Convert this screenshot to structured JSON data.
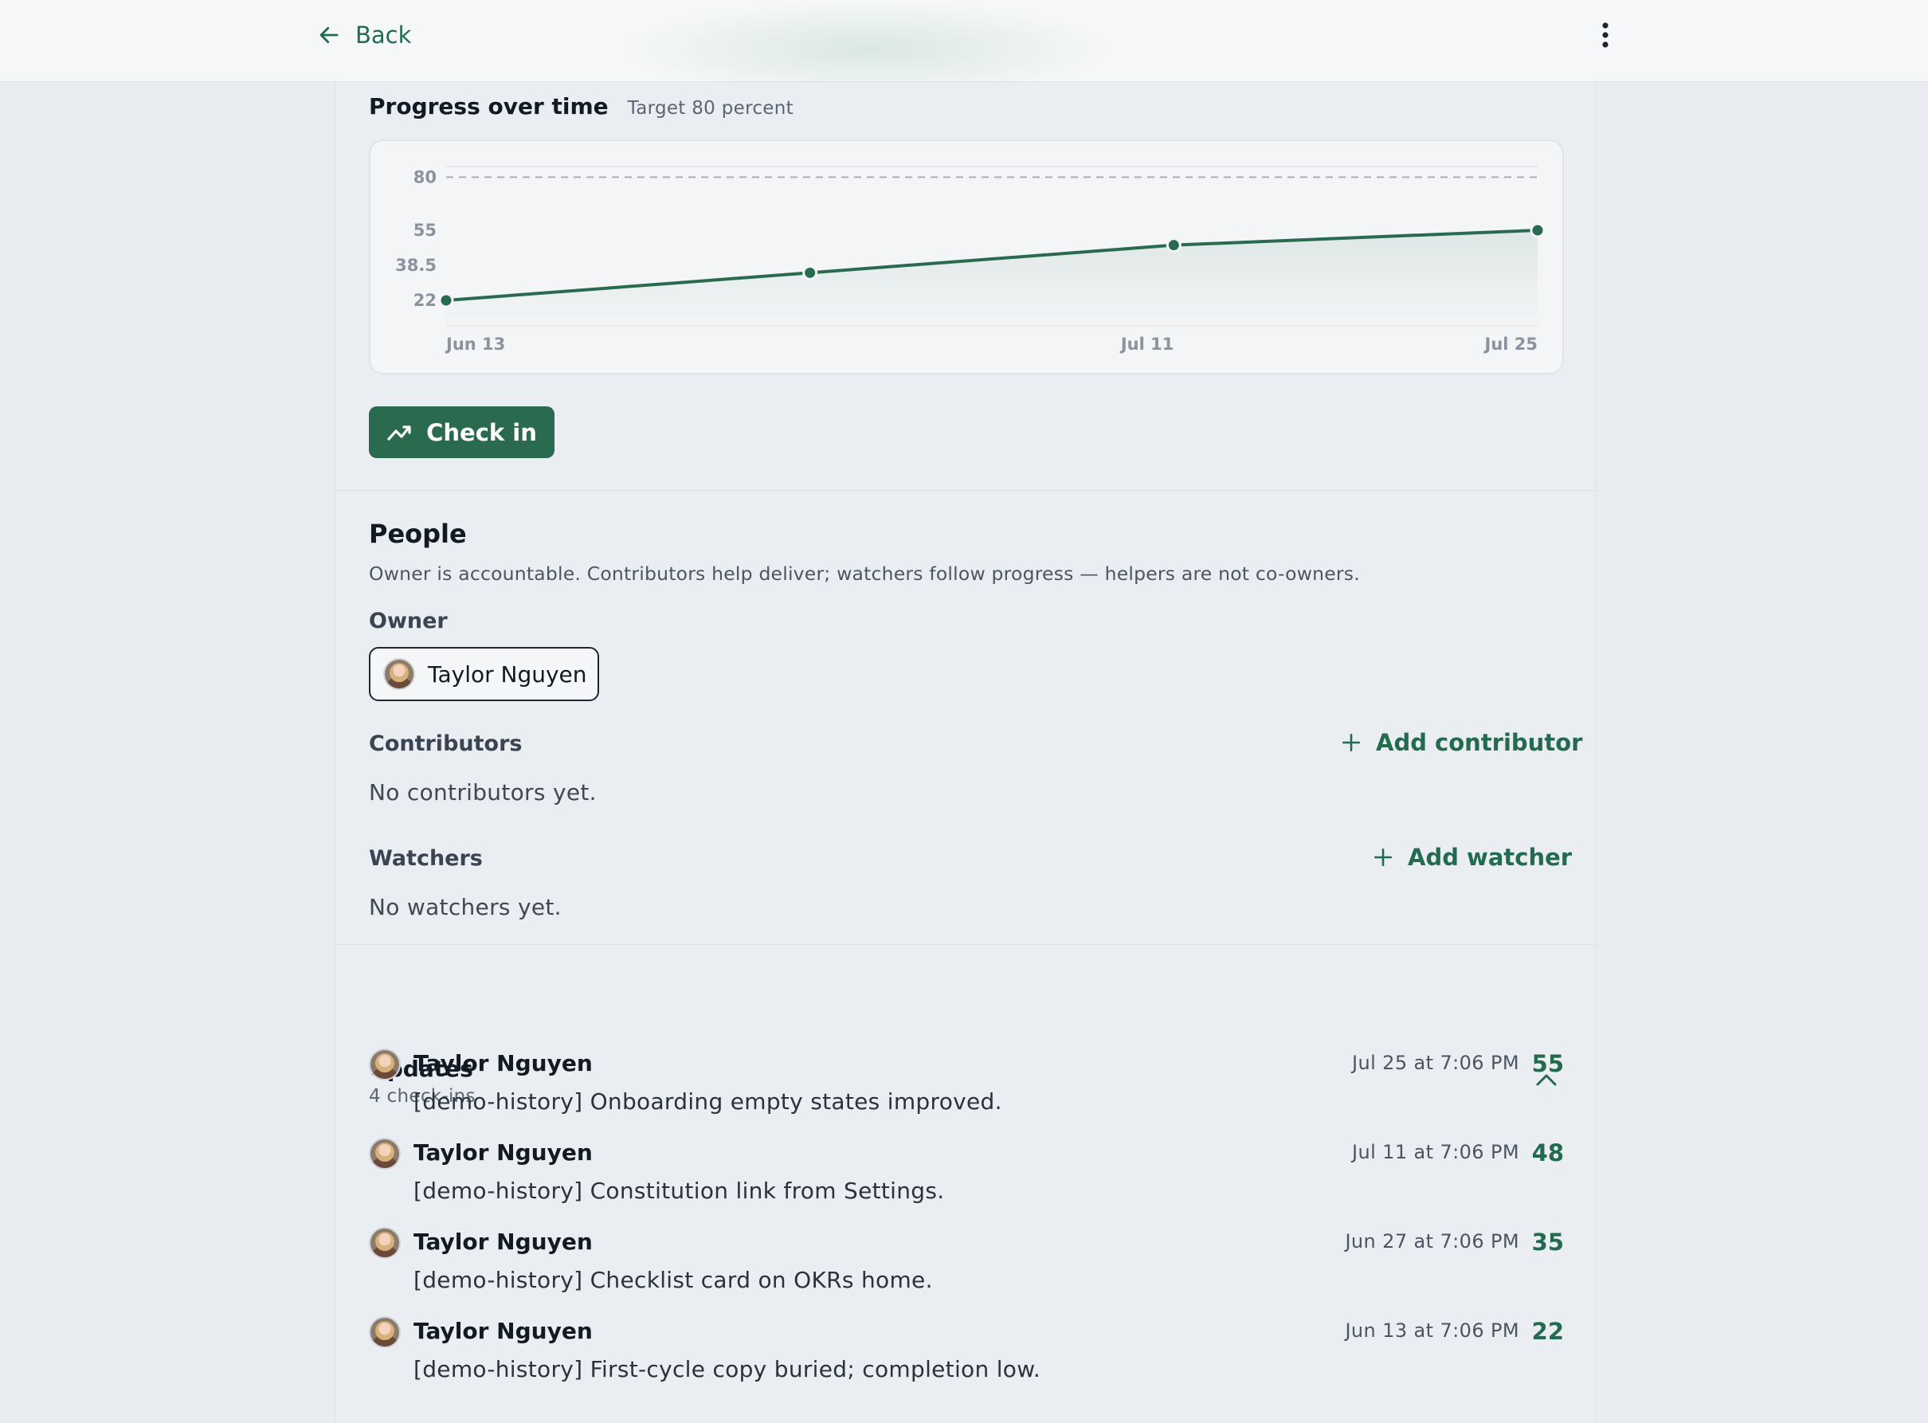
{
  "topbar": {
    "back_label": "Back",
    "back_icon": "arrow-left-icon",
    "menu_icon": "more-vertical-icon"
  },
  "progress": {
    "title": "Progress over time",
    "target_label": "Target 80 percent"
  },
  "chart_data": {
    "type": "line",
    "x": [
      "Jun 13",
      "Jun 27",
      "Jul 11",
      "Jul 25"
    ],
    "x_tick_labels": [
      "Jun 13",
      "Jul 11",
      "Jul 25"
    ],
    "y_tick_labels": [
      "80",
      "55",
      "38.5",
      "22"
    ],
    "y_ticks": [
      80,
      55,
      38.5,
      22
    ],
    "series": [
      {
        "values": [
          22,
          35,
          48,
          55
        ]
      }
    ],
    "target": 80,
    "ylim": [
      10,
      85
    ],
    "grid": true,
    "line_color": "#2a6b50",
    "target_color": "#a8b0ba"
  },
  "checkin": {
    "label": "Check in",
    "icon": "trend-line-icon"
  },
  "people": {
    "title": "People",
    "description": "Owner is accountable. Contributors help deliver; watchers follow progress — helpers are not co-owners.",
    "owner_label": "Owner",
    "owner_name": "Taylor Nguyen",
    "contributors_label": "Contributors",
    "add_contributor_label": "Add contributor",
    "contributors_empty": "No contributors yet.",
    "watchers_label": "Watchers",
    "add_watcher_label": "Add watcher",
    "watchers_empty": "No watchers yet."
  },
  "updates": {
    "title": "Updates",
    "count_label": "4 check-ins",
    "items": [
      {
        "author": "Taylor Nguyen",
        "time": "Jul 25 at 7:06 PM",
        "value": "55",
        "message": "[demo-history] Onboarding empty states improved."
      },
      {
        "author": "Taylor Nguyen",
        "time": "Jul 11 at 7:06 PM",
        "value": "48",
        "message": "[demo-history] Constitution link from Settings."
      },
      {
        "author": "Taylor Nguyen",
        "time": "Jun 27 at 7:06 PM",
        "value": "35",
        "message": "[demo-history] Checklist card on OKRs home."
      },
      {
        "author": "Taylor Nguyen",
        "time": "Jun 13 at 7:06 PM",
        "value": "22",
        "message": "[demo-history] First-cycle copy buried; completion low."
      }
    ]
  },
  "colors": {
    "accent": "#236b4f",
    "button_bg": "#2a6b50"
  }
}
